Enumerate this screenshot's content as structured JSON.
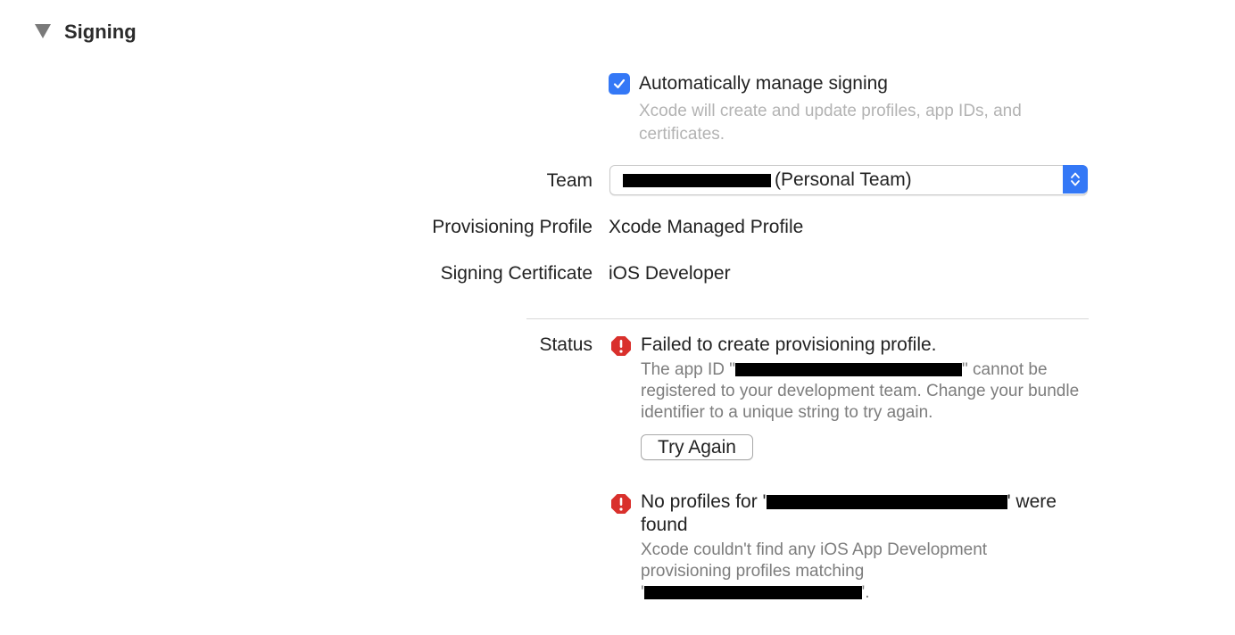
{
  "section": {
    "title": "Signing"
  },
  "auto_signing": {
    "checked": true,
    "label": "Automatically manage signing",
    "help": "Xcode will create and update profiles, app IDs, and certificates."
  },
  "team": {
    "label": "Team",
    "value_suffix": "(Personal Team)"
  },
  "provisioning_profile": {
    "label": "Provisioning Profile",
    "value": "Xcode Managed Profile"
  },
  "signing_certificate": {
    "label": "Signing Certificate",
    "value": "iOS Developer"
  },
  "status": {
    "label": "Status",
    "errors": [
      {
        "title": "Failed to create provisioning profile.",
        "body_prefix": "The app ID \"",
        "body_mid": "\" cannot be",
        "body_rest": "registered to your development team. Change your bundle identifier to a unique string to try again.",
        "button": "Try Again"
      },
      {
        "title_prefix": "No profiles for '",
        "title_suffix": "' were",
        "title_line2": "found",
        "body": "Xcode couldn't find any iOS App Development provisioning profiles matching",
        "body_end_prefix": "'",
        "body_end_suffix": "'."
      }
    ]
  },
  "colors": {
    "accent": "#3478f6",
    "error": "#d9302c",
    "secondary_text": "#7d7d7d",
    "disabled_text": "#b3b3b3"
  }
}
